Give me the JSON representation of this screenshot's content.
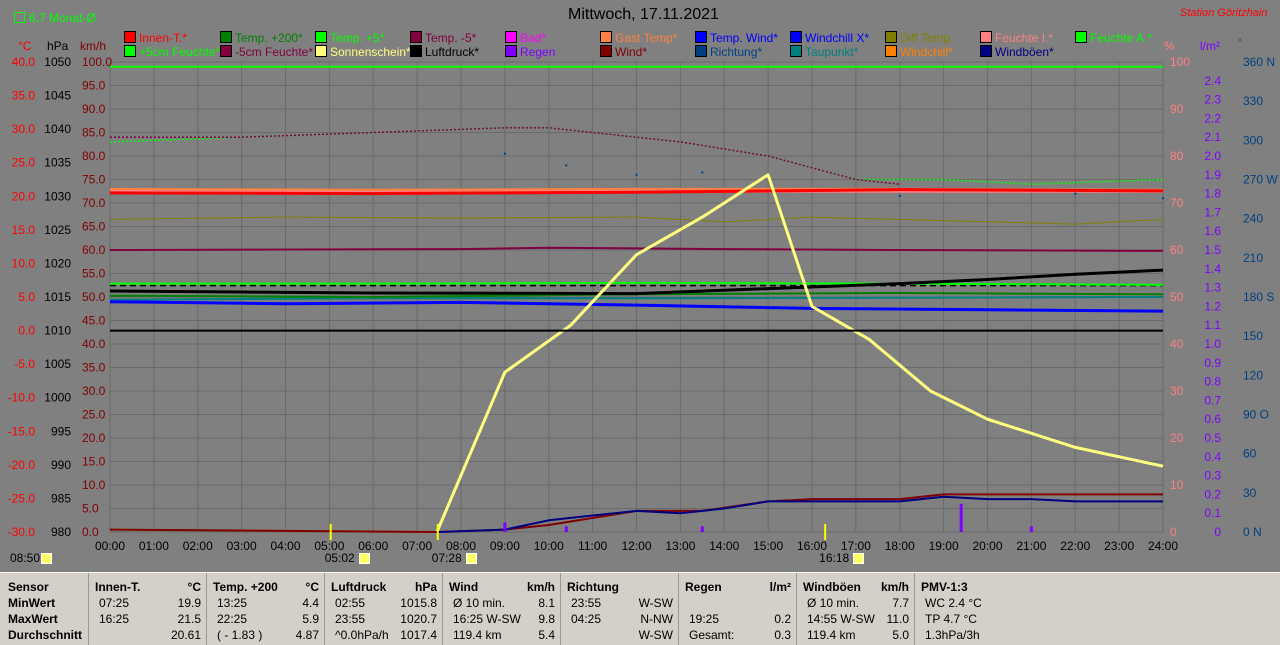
{
  "header": {
    "title": "Mittwoch, 17.11.2021",
    "station": "Station Göritzhain",
    "monat": "6.7 Monat-Ø"
  },
  "legend": [
    {
      "label": "Innen-T.*",
      "color": "#ff0000"
    },
    {
      "label": "Temp. +200*",
      "color": "#008000"
    },
    {
      "label": "Temp. +5*",
      "color": "#00ff00"
    },
    {
      "label": "Temp. -5*",
      "color": "#800040"
    },
    {
      "label": "Bad*",
      "color": "#ff00ff"
    },
    {
      "label": "Gast Temp*",
      "color": "#ff8040"
    },
    {
      "label": "Temp. Wind*",
      "color": "#0000ff"
    },
    {
      "label": "Windchill X*",
      "color": "#0000ff"
    },
    {
      "label": "Diff Temp.",
      "color": "#808000"
    },
    {
      "label": "Feuchte I.*",
      "color": "#ff8080"
    },
    {
      "label": "Feuchte A.*",
      "color": "#00ff00"
    },
    {
      "label": "+5cm Feuchte*",
      "color": "#00ff00"
    },
    {
      "label": "-5cm Feuchte*",
      "color": "#800040"
    },
    {
      "label": "Sonnenschein*",
      "color": "#ffff80"
    },
    {
      "label": "Luftdruck*",
      "color": "#000000"
    },
    {
      "label": "Regen",
      "color": "#8000ff"
    },
    {
      "label": "Wind*",
      "color": "#800000"
    },
    {
      "label": "Richtung*",
      "color": "#004080"
    },
    {
      "label": "Taupunkt*",
      "color": "#008080"
    },
    {
      "label": "Windchill*",
      "color": "#ff8000"
    },
    {
      "label": "Windböen*",
      "color": "#000080"
    }
  ],
  "axis_units": {
    "celsius": "°C",
    "hpa": "hPa",
    "kmh": "km/h",
    "percent": "%",
    "rain": "l/m²",
    "dir": "°"
  },
  "chart_data": {
    "type": "line",
    "title": "Mittwoch, 17.11.2021",
    "x_ticks": [
      "00:00",
      "01:00",
      "02:00",
      "03:00",
      "04:00",
      "05:00",
      "06:00",
      "07:00",
      "08:00",
      "09:00",
      "10:00",
      "11:00",
      "12:00",
      "13:00",
      "14:00",
      "15:00",
      "16:00",
      "17:00",
      "18:00",
      "19:00",
      "20:00",
      "21:00",
      "22:00",
      "23:00",
      "24:00"
    ],
    "celsius_ticks": [
      "40.0",
      "35.0",
      "30.0",
      "25.0",
      "20.0",
      "15.0",
      "10.0",
      "5.0",
      "0.0",
      "-5.0",
      "-10.0",
      "-15.0",
      "-20.0",
      "-25.0",
      "-30.0"
    ],
    "hpa_ticks": [
      "1050",
      "1045",
      "1040",
      "1035",
      "1030",
      "1025",
      "1020",
      "1015",
      "1010",
      "1005",
      "1000",
      "995",
      "990",
      "985",
      "980"
    ],
    "kmh_ticks": [
      "100.0",
      "95.0",
      "90.0",
      "85.0",
      "80.0",
      "75.0",
      "70.0",
      "65.0",
      "60.0",
      "55.0",
      "50.0",
      "45.0",
      "40.0",
      "35.0",
      "30.0",
      "25.0",
      "20.0",
      "15.0",
      "10.0",
      "5.0",
      "0.0"
    ],
    "percent_ticks": [
      "100",
      "90",
      "80",
      "70",
      "60",
      "50",
      "40",
      "30",
      "20",
      "10",
      "0"
    ],
    "rain_ticks": [
      "2.4",
      "2.3",
      "2.2",
      "2.1",
      "2.0",
      "1.9",
      "1.8",
      "1.7",
      "1.6",
      "1.5",
      "1.4",
      "1.3",
      "1.2",
      "1.1",
      "1.0",
      "0.9",
      "0.8",
      "0.7",
      "0.6",
      "0.5",
      "0.4",
      "0.3",
      "0.2",
      "0.1",
      "0"
    ],
    "dir_ticks": [
      "360 N",
      "330",
      "300",
      "270 W",
      "240",
      "210",
      "180 S",
      "150",
      "120",
      "90 O",
      "60",
      "30",
      "0 N"
    ],
    "ylim_celsius": [
      -30,
      40
    ],
    "ylim_kmh": [
      0,
      100
    ],
    "series": [
      {
        "name": "Feuchte A.*",
        "axis": "kmh",
        "color": "#00ff00",
        "dash": "2,2",
        "x": [
          0,
          3,
          6,
          9,
          10,
          13,
          15,
          17,
          19,
          21,
          24
        ],
        "y": [
          83,
          84,
          85,
          86,
          86,
          83,
          80,
          75,
          75,
          74,
          75
        ]
      },
      {
        "name": "-5cm Feuchte*",
        "axis": "kmh",
        "color": "#800040",
        "dash": "2,2",
        "x": [
          0,
          3,
          6,
          9,
          10,
          13,
          15,
          17,
          18
        ],
        "y": [
          84,
          84,
          85,
          86,
          86,
          83,
          80,
          75,
          74
        ]
      },
      {
        "name": "Feuchte I.*",
        "axis": "kmh",
        "color": "#ff8080",
        "width": 3,
        "x": [
          0,
          24
        ],
        "y": [
          72.5,
          72.5
        ]
      },
      {
        "name": "Gast Temp*",
        "axis": "kmh",
        "color": "#ff8040",
        "width": 2,
        "x": [
          0,
          6,
          12,
          18,
          24
        ],
        "y": [
          73,
          72.8,
          73,
          73,
          72.8
        ]
      },
      {
        "name": "Innen-T.*",
        "axis": "celsius",
        "color": "#ff0000",
        "width": 3,
        "x": [
          0,
          6,
          12,
          18,
          24
        ],
        "y": [
          20.5,
          20.4,
          20.6,
          21.0,
          20.8
        ]
      },
      {
        "name": "Diff Temp.",
        "axis": "kmh",
        "color": "#808000",
        "width": 1,
        "x": [
          0,
          4,
          8,
          12,
          14,
          16,
          20,
          22,
          24
        ],
        "y": [
          66.5,
          67,
          66.8,
          67,
          66,
          67,
          66,
          65.5,
          66.5
        ]
      },
      {
        "name": "Temp. -5*",
        "axis": "kmh",
        "color": "#800040",
        "width": 2,
        "x": [
          0,
          8,
          10,
          14,
          18,
          24
        ],
        "y": [
          60,
          60.2,
          60.5,
          60.2,
          60,
          59.8
        ]
      },
      {
        "name": "Temp. +5*",
        "axis": "celsius",
        "color": "#00ff00",
        "width": 2,
        "x": [
          0,
          6,
          12,
          18,
          24
        ],
        "y": [
          7.0,
          7.0,
          7.1,
          7.0,
          6.8
        ]
      },
      {
        "name": "Taupunkt*",
        "axis": "celsius",
        "color": "#008080",
        "width": 2,
        "x": [
          0,
          6,
          12,
          18,
          24
        ],
        "y": [
          4.6,
          4.8,
          4.8,
          4.9,
          5.0
        ]
      },
      {
        "name": "Temp. +200*",
        "axis": "celsius",
        "color": "#008000",
        "width": 2,
        "x": [
          0,
          6,
          12,
          18,
          24
        ],
        "y": [
          5.2,
          5.0,
          5.4,
          5.6,
          5.4
        ]
      },
      {
        "name": "Luftdruck*",
        "axis": "celsius",
        "color": "#000000",
        "width": 3,
        "x": [
          0,
          6,
          12,
          18,
          20,
          22,
          24
        ],
        "y": [
          5.9,
          5.6,
          5.5,
          7.0,
          7.6,
          8.4,
          9.0
        ]
      },
      {
        "name": "Temp. Wind*",
        "axis": "celsius",
        "color": "#0000ff",
        "width": 3,
        "x": [
          0,
          4,
          8,
          12,
          16,
          20,
          24
        ],
        "y": [
          4.3,
          4.0,
          4.2,
          3.8,
          3.3,
          3.1,
          2.9
        ]
      },
      {
        "name": "Sonnenschein*",
        "axis": "kmh",
        "color": "#ffff80",
        "width": 3,
        "x": [
          7.45,
          9,
          10.5,
          12,
          13.5,
          15,
          16,
          17.3,
          18.7,
          20,
          22,
          24
        ],
        "y": [
          0,
          34,
          44,
          59,
          67,
          76,
          48,
          41,
          30,
          24,
          18,
          14
        ]
      },
      {
        "name": "Wind*",
        "axis": "kmh",
        "color": "#800000",
        "width": 2,
        "x": [
          0,
          7.5,
          9,
          10,
          12,
          13.5,
          15,
          16,
          17,
          18,
          19,
          20,
          21,
          22,
          24
        ],
        "y": [
          0.5,
          0,
          0.5,
          1.5,
          4.5,
          4.5,
          6.5,
          7,
          7,
          7,
          8,
          8,
          8,
          8,
          8
        ]
      },
      {
        "name": "Windböen*",
        "axis": "kmh",
        "color": "#000080",
        "width": 2,
        "x": [
          7.5,
          9,
          10,
          11,
          12,
          13,
          14,
          15,
          16,
          17,
          18,
          19,
          20,
          21,
          22,
          24
        ],
        "y": [
          0,
          0.5,
          2.5,
          3.5,
          4.5,
          4,
          5,
          6.5,
          6.5,
          6.5,
          6.5,
          7.5,
          7,
          7,
          6.5,
          6.5
        ]
      },
      {
        "name": "+5cm Feuchte*",
        "axis": "kmh",
        "color": "#00ff00",
        "width": 2,
        "x": [
          0,
          24
        ],
        "y": [
          99,
          99
        ]
      },
      {
        "name": "Temp. Wind*",
        "axis": "celsius",
        "color": "#000000",
        "width": 2,
        "x": [
          0,
          24
        ],
        "y": [
          0,
          0
        ]
      }
    ],
    "reference_lines": [
      {
        "name": "6.7 Monat-Ø",
        "axis": "celsius",
        "value": 6.7,
        "color": "#000000",
        "dash": "6,4"
      }
    ],
    "rain_bars": [
      {
        "x": 9.0,
        "y": 0.05
      },
      {
        "x": 10.4,
        "y": 0.03
      },
      {
        "x": 13.5,
        "y": 0.03
      },
      {
        "x": 19.4,
        "y": 0.15
      },
      {
        "x": 21.0,
        "y": 0.03
      }
    ],
    "direction_dots": [
      {
        "x": 9.0,
        "y": 80.5
      },
      {
        "x": 10.4,
        "y": 78
      },
      {
        "x": 12.0,
        "y": 76
      },
      {
        "x": 13.5,
        "y": 76.5
      },
      {
        "x": 18.0,
        "y": 71.5
      },
      {
        "x": 22.0,
        "y": 72
      },
      {
        "x": 24.0,
        "y": 71
      }
    ],
    "sun_events": [
      {
        "label": "05:02",
        "x": 5.03
      },
      {
        "label": "07:28",
        "x": 7.47
      },
      {
        "label": "16:18",
        "x": 16.3
      },
      {
        "label": "08:50",
        "x": 0
      }
    ]
  },
  "stats": {
    "row_labels": [
      "Sensor",
      "MinWert",
      "MaxWert",
      "Durchschnitt"
    ],
    "columns": [
      {
        "title": "Innen-T.",
        "unit": "°C",
        "rows": [
          [
            "07:25",
            "19.9"
          ],
          [
            "16:25",
            "21.5"
          ],
          [
            "",
            "20.61"
          ]
        ]
      },
      {
        "title": "Temp. +200",
        "unit": "°C",
        "rows": [
          [
            "13:25",
            "4.4"
          ],
          [
            "22:25",
            "5.9"
          ],
          [
            "( - 1.83 )",
            "4.87"
          ]
        ]
      },
      {
        "title": "Luftdruck",
        "unit": "hPa",
        "rows": [
          [
            "02:55",
            "1015.8"
          ],
          [
            "23:55",
            "1020.7"
          ],
          [
            "^0.0hPa/h",
            "1017.4"
          ]
        ]
      },
      {
        "title": "Wind",
        "unit": "km/h",
        "rows": [
          [
            "Ø 10 min.",
            "8.1"
          ],
          [
            "16:25  W-SW",
            "9.8"
          ],
          [
            "119.4 km",
            "5.4"
          ]
        ]
      },
      {
        "title": "Richtung",
        "unit": "",
        "rows": [
          [
            "23:55",
            "W-SW"
          ],
          [
            "04:25",
            "N-NW"
          ],
          [
            "",
            "W-SW"
          ]
        ]
      },
      {
        "title": "Regen",
        "unit": "l/m²",
        "rows": [
          [
            "",
            ""
          ],
          [
            "19:25",
            "0.2"
          ],
          [
            "Gesamt:",
            "0.3"
          ]
        ]
      },
      {
        "title": "Windböen",
        "unit": "km/h",
        "rows": [
          [
            "Ø 10 min.",
            "7.7"
          ],
          [
            "14:55  W-SW",
            "11.0"
          ],
          [
            "119.4 km",
            "5.0"
          ]
        ]
      },
      {
        "title": "PMV-1:3",
        "unit": "",
        "rows": [
          [
            "WC 2.4 °C",
            ""
          ],
          [
            "TP 4.7 °C",
            ""
          ],
          [
            "1.3hPa/3h",
            ""
          ]
        ]
      }
    ]
  }
}
